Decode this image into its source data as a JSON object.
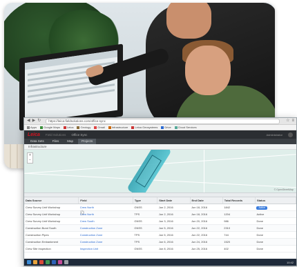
{
  "browser": {
    "url": "https://leica-fieldsolutions.com/office-sync",
    "bookmarks": [
      "Apps",
      "Google Maps",
      "Leica",
      "Geology",
      "Gmail",
      "Infrastructure",
      "Leica Geosystems",
      "Drive",
      "Cloud Services"
    ]
  },
  "app": {
    "logo": "Leica",
    "title": "Office Sync",
    "subtitle": "Field Solutions",
    "user": "Administrator",
    "tabs": [
      "Data Sets",
      "Files",
      "Map",
      "Projects"
    ],
    "active_tab": 3,
    "subheader": "Infrastructure",
    "map_attribution": "© OpenStreetMap"
  },
  "table": {
    "columns": [
      "Data Source",
      "Field",
      "Type",
      "Start Date",
      "End Date",
      "Total Records",
      "Status"
    ],
    "rows": [
      [
        "Crew Survey Unit Workshop",
        "Crew North",
        "GNSS",
        "Jun 2, 2016",
        "Jun 18, 2016",
        "1842",
        "Active"
      ],
      [
        "Crew Survey Unit Workshop",
        "Crew North",
        "TPS",
        "Jun 2, 2016",
        "Jun 18, 2016",
        "1204",
        "Active"
      ],
      [
        "Crew Survey Unit Workshop",
        "Crew South",
        "GNSS",
        "Jun 3, 2016",
        "Jun 20, 2016",
        "986",
        "Done"
      ],
      [
        "Construction Bund South",
        "Construction Zone",
        "GNSS",
        "Jun 5, 2016",
        "Jun 22, 2016",
        "2310",
        "Done"
      ],
      [
        "Construction Pipes",
        "Construction Zone",
        "TPS",
        "Jun 5, 2016",
        "Jun 22, 2016",
        "744",
        "Done"
      ],
      [
        "Construction Embankment",
        "Construction Zone",
        "TPS",
        "Jun 6, 2016",
        "Jun 24, 2016",
        "1520",
        "Done"
      ],
      [
        "Crew Site Inspection",
        "Inspection Unit",
        "GNSS",
        "Jun 8, 2016",
        "Jun 25, 2016",
        "402",
        "Done"
      ]
    ]
  },
  "taskbar": {
    "time": "10:42"
  }
}
